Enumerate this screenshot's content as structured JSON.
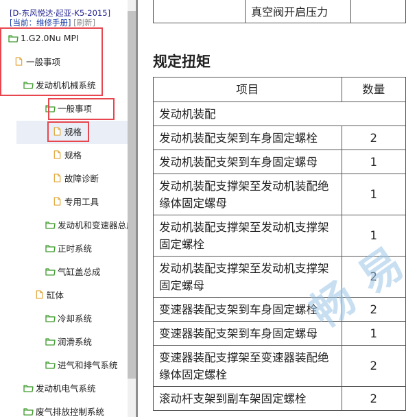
{
  "header": {
    "title": "[D-东风悦达·起亚-K5-2015]",
    "current_prefix": "[当前：维修手册]",
    "refresh": "[刷新]"
  },
  "tree": {
    "root": "1.G2.0Nu MPI",
    "general": "一般事项",
    "engine_mech": "发动机机械系统",
    "em_general": "一般事项",
    "spec_highlighted": "规格",
    "spec": "规格",
    "diagnosis": "故障诊断",
    "special_tools": "专用工具",
    "engine_trans": "发动机和变速器总成",
    "timing": "正时系统",
    "cylinder_head": "气缸盖总成",
    "cylinder_block": "缸体",
    "cooling": "冷却系统",
    "lubrication": "润滑系统",
    "intake_exhaust": "进气和排气系统",
    "engine_electrical": "发动机电气系统",
    "emission": "废气排放控制系统"
  },
  "content": {
    "top_row_label": "真空阀开启压力",
    "section_title": "规定扭矩",
    "col_item": "项目",
    "col_qty": "数量",
    "group": "发动机装配",
    "rows": [
      {
        "item": "发动机装配支架到车身固定螺栓",
        "qty": "2"
      },
      {
        "item": "发动机装配支架到车身固定螺母",
        "qty": "1"
      },
      {
        "item": "发动机装配支撑架至发动机装配绝缘体固定螺母",
        "qty": "1"
      },
      {
        "item": "发动机装配支撑架至发动机支撑架固定螺栓",
        "qty": "1"
      },
      {
        "item": "发动机装配支撑架至发动机支撑架固定螺母",
        "qty": "2"
      },
      {
        "item": "变速器装配支架到车身固定螺栓",
        "qty": "2"
      },
      {
        "item": "变速器装配支架到车身固定螺母",
        "qty": "1"
      },
      {
        "item": "变速器装配支撑架至变速器装配绝缘体固定螺栓",
        "qty": "2"
      },
      {
        "item": "滚动杆支架到副车架固定螺栓",
        "qty": "2"
      }
    ]
  },
  "icons": {
    "folder_color": "#3d9a2c",
    "file_color": "#e0a63a",
    "highlight_color": "#e8464f"
  }
}
